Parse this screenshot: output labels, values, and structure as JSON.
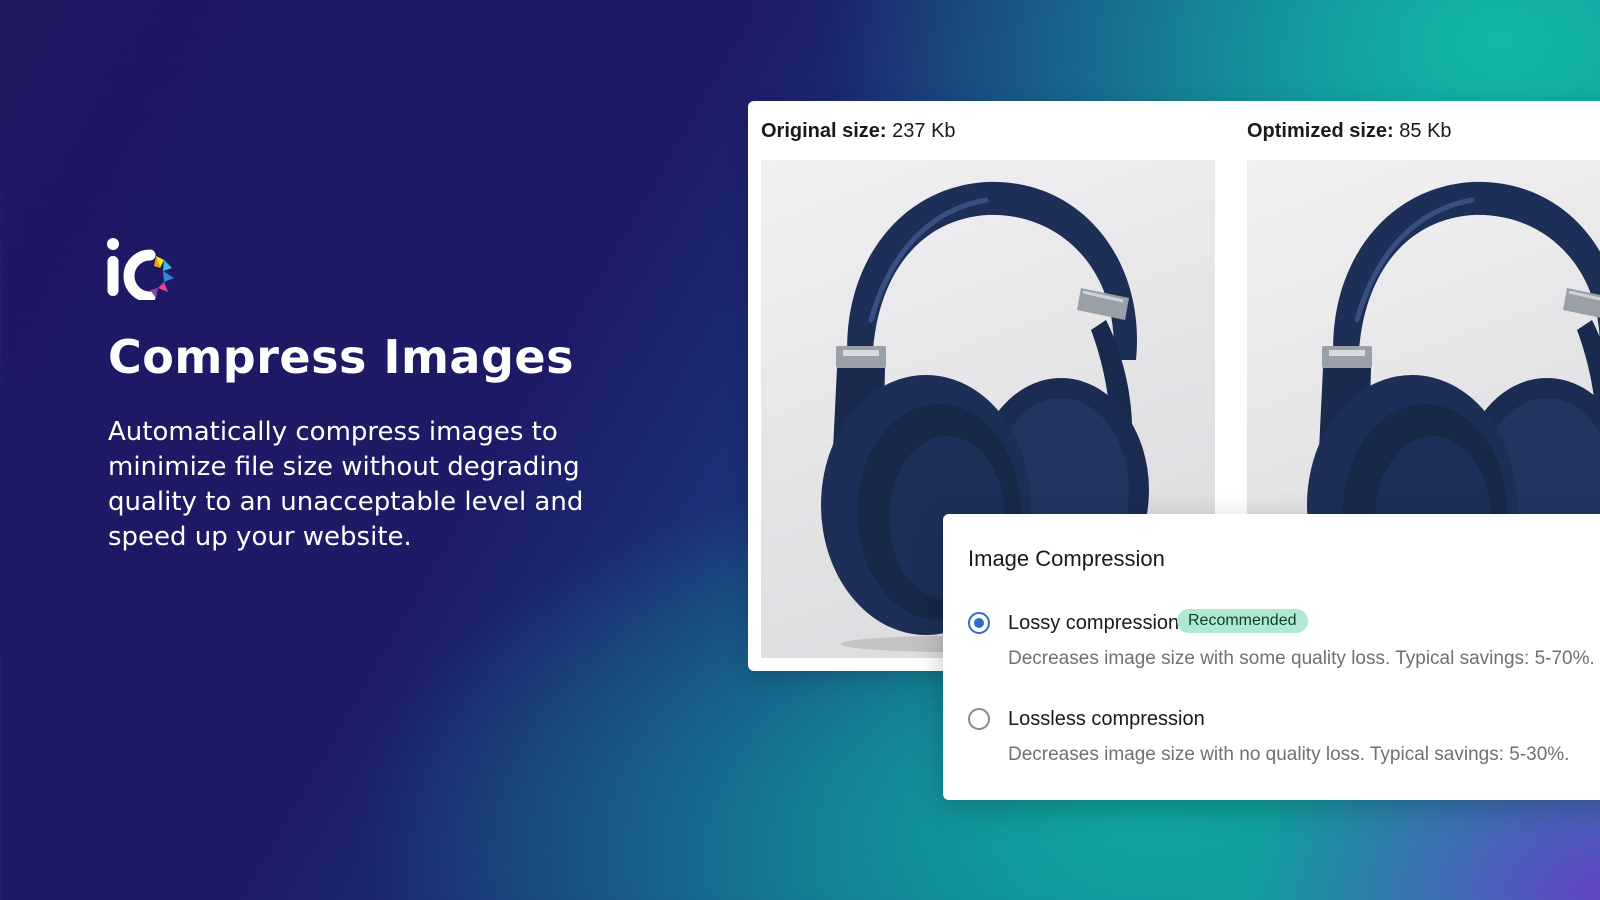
{
  "hero": {
    "logo_text": "iO",
    "title": "Compress Images",
    "description": "Automatically compress images to minimize file size without degrading quality to an unacceptable level and speed up your website."
  },
  "comparison": {
    "original": {
      "label": "Original size:",
      "value": "237 Kb"
    },
    "optimized": {
      "label": "Optimized size:",
      "value": "85 Kb"
    },
    "image_subject": "navy-headphones"
  },
  "compression": {
    "title": "Image Compression",
    "options": [
      {
        "label": "Lossy compression",
        "badge": "Recommended",
        "description": "Decreases image size with some quality loss. Typical savings: 5-70%.",
        "selected": true
      },
      {
        "label": "Lossless compression",
        "description": "Decreases image size with no quality loss. Typical savings: 5-30%.",
        "selected": false
      }
    ]
  },
  "colors": {
    "accent": "#2c6ecb",
    "badge_bg": "#aee9d1",
    "bg_dark": "#1f1863",
    "bg_teal": "#12b8a8",
    "bg_purple": "#6a3ac9",
    "headphone_navy": "#1e2f57"
  },
  "icons": [
    "logo-mark",
    "radio-checked",
    "radio-unchecked"
  ]
}
